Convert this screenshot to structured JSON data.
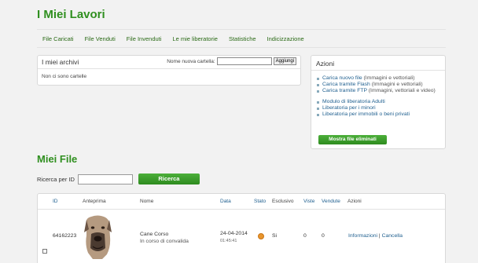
{
  "page_title": "I Miei Lavori",
  "tabs": [
    "File Caricati",
    "File Venduti",
    "File Invenduti",
    "Le mie liberatorie",
    "Statistiche",
    "Indicizzazione"
  ],
  "archivi": {
    "title": "I miei archivi",
    "new_folder_label": "Nome nuova cartella:",
    "new_folder_value": "",
    "add_button": "Aggiungi",
    "empty_text": "Non ci sono cartelle"
  },
  "azioni": {
    "title": "Azioni",
    "items": [
      {
        "link": "Carica nuovo file",
        "note": "(Immagini e vettoriali)"
      },
      {
        "link": "Carica tramite Flash",
        "note": "(Immagini e vettoriali)"
      },
      {
        "link": "Carica tramite FTP",
        "note": "(Immagini, vettoriali e video)"
      }
    ],
    "items2": [
      {
        "link": "Modulo di liberatoria Adulti"
      },
      {
        "link": "Liberatoria per i minori"
      },
      {
        "link": "Liberatoria per immobili o beni privati"
      }
    ],
    "show_deleted_button": "Mostra file eliminati"
  },
  "miei_file": {
    "title": "Miei File",
    "search_label": "Ricerca per ID",
    "search_value": "",
    "search_button": "Ricerca"
  },
  "table": {
    "headers": {
      "id": "ID",
      "preview": "Anteprima",
      "name": "Nome",
      "date": "Data",
      "state": "Stato",
      "exclusive": "Esclusivo",
      "views": "Viste",
      "sold": "Vendute",
      "actions": "Azioni"
    },
    "rows": [
      {
        "id": "64162223",
        "name": "Cane Corso",
        "status_text": "In corso di convalida",
        "date": "24-04-2014",
        "time": "01:45:41",
        "exclusive": "Si",
        "views": "0",
        "sold": "0",
        "action_info": "Informazioni",
        "action_sep": "|",
        "action_delete": "Cancella"
      }
    ]
  },
  "colors": {
    "accent_green": "#2f8f1f",
    "link_blue": "#1f5f8f",
    "status_orange": "#e8952d"
  }
}
